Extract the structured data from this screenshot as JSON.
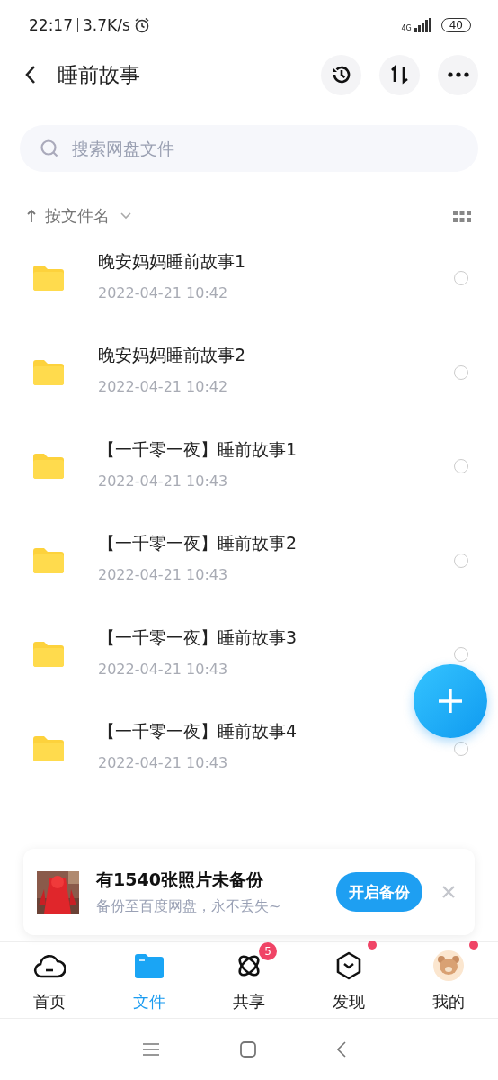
{
  "status_bar": {
    "time": "22:17",
    "speed": "3.7K/s",
    "network": "4G",
    "battery": "40"
  },
  "header": {
    "title": "睡前故事"
  },
  "search": {
    "placeholder": "搜索网盘文件"
  },
  "sort": {
    "label": "按文件名"
  },
  "files": [
    {
      "name": "晚安妈妈睡前故事1",
      "date": "2022-04-21  10:42",
      "checked": false
    },
    {
      "name": "晚安妈妈睡前故事2",
      "date": "2022-04-21  10:42",
      "checked": false
    },
    {
      "name": "【一千零一夜】睡前故事1",
      "date": "2022-04-21  10:43",
      "checked": false
    },
    {
      "name": "【一千零一夜】睡前故事2",
      "date": "2022-04-21  10:43",
      "checked": false
    },
    {
      "name": "【一千零一夜】睡前故事3",
      "date": "2022-04-21  10:43",
      "checked": false
    },
    {
      "name": "【一千零一夜】睡前故事4",
      "date": "2022-04-21  10:43",
      "checked": false
    }
  ],
  "backup_card": {
    "title": "有1540张照片未备份",
    "subtitle": "备份至百度网盘，永不丢失~",
    "button": "开启备份"
  },
  "tabs": [
    {
      "kind": "home",
      "label": "首页",
      "selected": false,
      "dot": false
    },
    {
      "kind": "files",
      "label": "文件",
      "selected": true,
      "dot": false
    },
    {
      "kind": "share",
      "label": "共享",
      "selected": false,
      "badge": "5",
      "dot": false
    },
    {
      "kind": "discover",
      "label": "发现",
      "selected": false,
      "dot": true
    },
    {
      "kind": "me",
      "label": "我的",
      "selected": false,
      "dot": true
    }
  ]
}
